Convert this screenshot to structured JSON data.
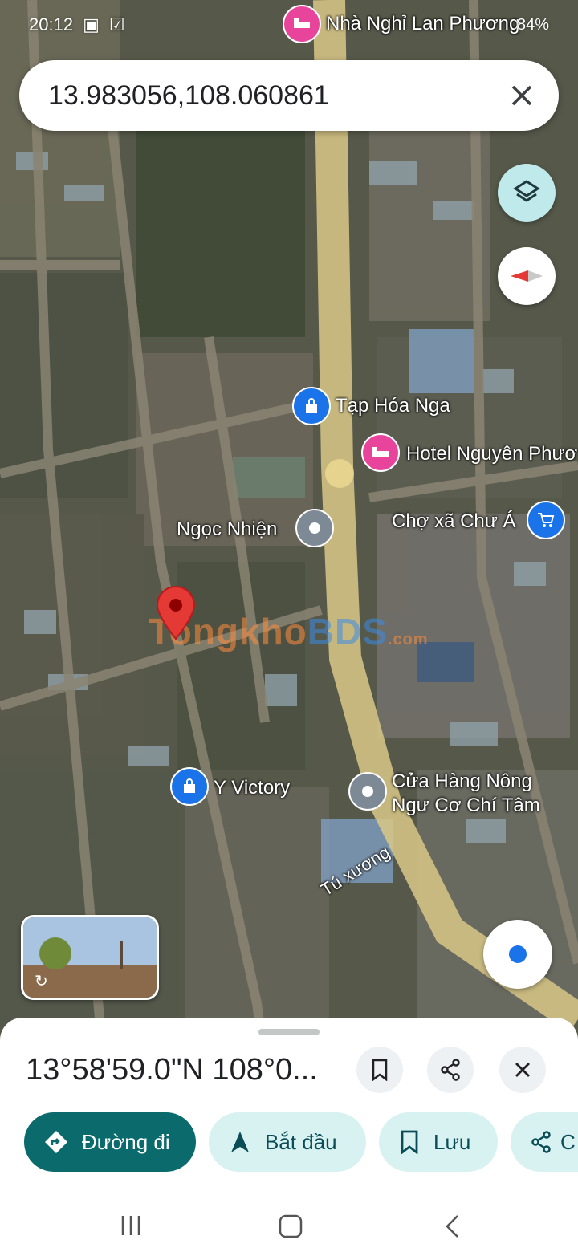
{
  "status": {
    "time": "20:12",
    "battery": "84%"
  },
  "search": {
    "value": "13.983056,108.060861"
  },
  "map": {
    "places": [
      {
        "name": "Nhà Nghỉ Lan Phương",
        "type": "hotel"
      },
      {
        "name": "Tạp Hóa Nga",
        "type": "shop"
      },
      {
        "name": "Hotel Nguyên Phươ",
        "type": "hotel"
      },
      {
        "name": "Ngọc Nhiện",
        "type": "place"
      },
      {
        "name": "Chợ xã Chư Á",
        "type": "market"
      },
      {
        "name": "Y Victory",
        "type": "shop"
      },
      {
        "name": "Cửa Hàng Nông",
        "type": "place"
      },
      {
        "name": "Ngư Cơ Chí Tâm",
        "type": "place"
      }
    ],
    "road_label": "Tú xương",
    "watermark": {
      "a": "Tongkho",
      "b": "BDS",
      "c": ".com"
    }
  },
  "sheet": {
    "title": "13°58'59.0\"N 108°0...",
    "actions": {
      "directions": "Đường đi",
      "start": "Bắt đầu",
      "save": "Lưu",
      "share": "C"
    }
  },
  "colors": {
    "primary": "#0b6b6c",
    "secondary_bg": "#d8f2f2",
    "hotel_pin": "#e8449b",
    "shop_pin": "#1a73e8",
    "road": "#d9c887"
  }
}
